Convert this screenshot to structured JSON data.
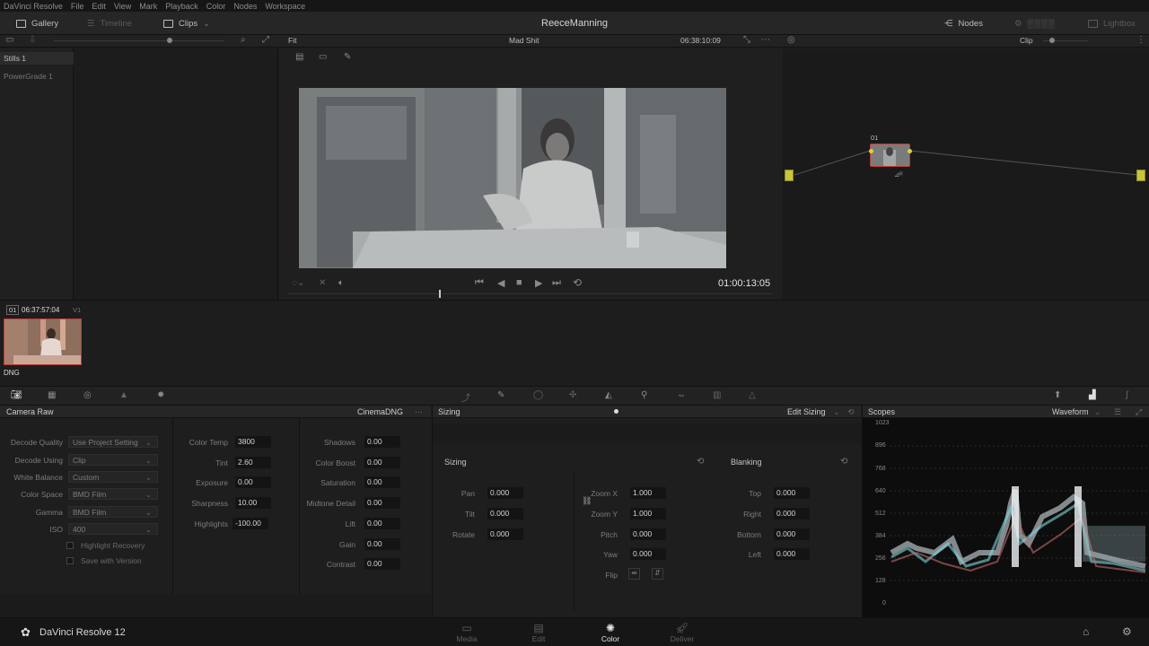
{
  "menu": [
    "DaVinci Resolve",
    "File",
    "Edit",
    "View",
    "Mark",
    "Playback",
    "Color",
    "Nodes",
    "Workspace"
  ],
  "topbar": {
    "gallery": "Gallery",
    "timeline": "Timeline",
    "clips": "Clips",
    "project_title": "ReeceManning",
    "nodes": "Nodes",
    "lightbox": "Lightbox"
  },
  "subbar": {
    "fit": "Fit",
    "timeline_name": "Mad Shit",
    "timecode": "06:38:10:09",
    "clip_mode": "Clip"
  },
  "gallery": {
    "albums": [
      "Stills 1",
      "PowerGrade 1"
    ]
  },
  "viewer": {
    "timecode": "01:00:13:05"
  },
  "node": {
    "number": "01"
  },
  "clip": {
    "index": "01",
    "timecode": "06:37:57:04",
    "track": "V1",
    "codec": "DNG"
  },
  "camera_raw": {
    "title": "Camera Raw",
    "format": "CinemaDNG",
    "left_settings": [
      {
        "label": "Decode Quality",
        "value": "Use Project Setting"
      },
      {
        "label": "Decode Using",
        "value": "Clip"
      },
      {
        "label": "White Balance",
        "value": "Custom"
      },
      {
        "label": "Color Space",
        "value": "BMD Film"
      },
      {
        "label": "Gamma",
        "value": "BMD Film"
      },
      {
        "label": "ISO",
        "value": "400"
      }
    ],
    "checkboxes": [
      "Highlight Recovery",
      "Save with Version"
    ],
    "mid_params": [
      {
        "label": "Color Temp",
        "value": "3800"
      },
      {
        "label": "Tint",
        "value": "2.60"
      },
      {
        "label": "Exposure",
        "value": "0.00"
      },
      {
        "label": "Sharpness",
        "value": "10.00"
      },
      {
        "label": "Highlights",
        "value": "-100.00"
      }
    ],
    "right_params": [
      {
        "label": "Shadows",
        "value": "0.00"
      },
      {
        "label": "Color Boost",
        "value": "0.00"
      },
      {
        "label": "Saturation",
        "value": "0.00"
      },
      {
        "label": "Midtone Detail",
        "value": "0.00"
      },
      {
        "label": "Lift",
        "value": "0.00"
      },
      {
        "label": "Gain",
        "value": "0.00"
      },
      {
        "label": "Contrast",
        "value": "0.00"
      }
    ]
  },
  "sizing": {
    "title": "Sizing",
    "mode": "Edit Sizing",
    "section": "Sizing",
    "blanking": "Blanking",
    "col1": [
      {
        "label": "Pan",
        "value": "0.000"
      },
      {
        "label": "Tilt",
        "value": "0.000"
      },
      {
        "label": "Rotate",
        "value": "0.000"
      }
    ],
    "col2": [
      {
        "label": "Zoom X",
        "value": "1.000"
      },
      {
        "label": "Zoom Y",
        "value": "1.000"
      },
      {
        "label": "Pitch",
        "value": "0.000"
      },
      {
        "label": "Yaw",
        "value": "0.000"
      }
    ],
    "flip": "Flip",
    "col3": [
      {
        "label": "Top",
        "value": "0.000"
      },
      {
        "label": "Right",
        "value": "0.000"
      },
      {
        "label": "Bottom",
        "value": "0.000"
      },
      {
        "label": "Left",
        "value": "0.000"
      }
    ]
  },
  "scopes": {
    "title": "Scopes",
    "type": "Waveform",
    "ticks": [
      "1023",
      "896",
      "768",
      "640",
      "512",
      "384",
      "256",
      "128",
      "0"
    ]
  },
  "footer": {
    "app": "DaVinci Resolve 12",
    "pages": [
      "Media",
      "Edit",
      "Color",
      "Deliver"
    ],
    "active_page": "Color"
  },
  "colors": {
    "accent_red": "#c23a3a",
    "node_yellow": "#d8d23a",
    "bg": "#1e1e1e"
  }
}
